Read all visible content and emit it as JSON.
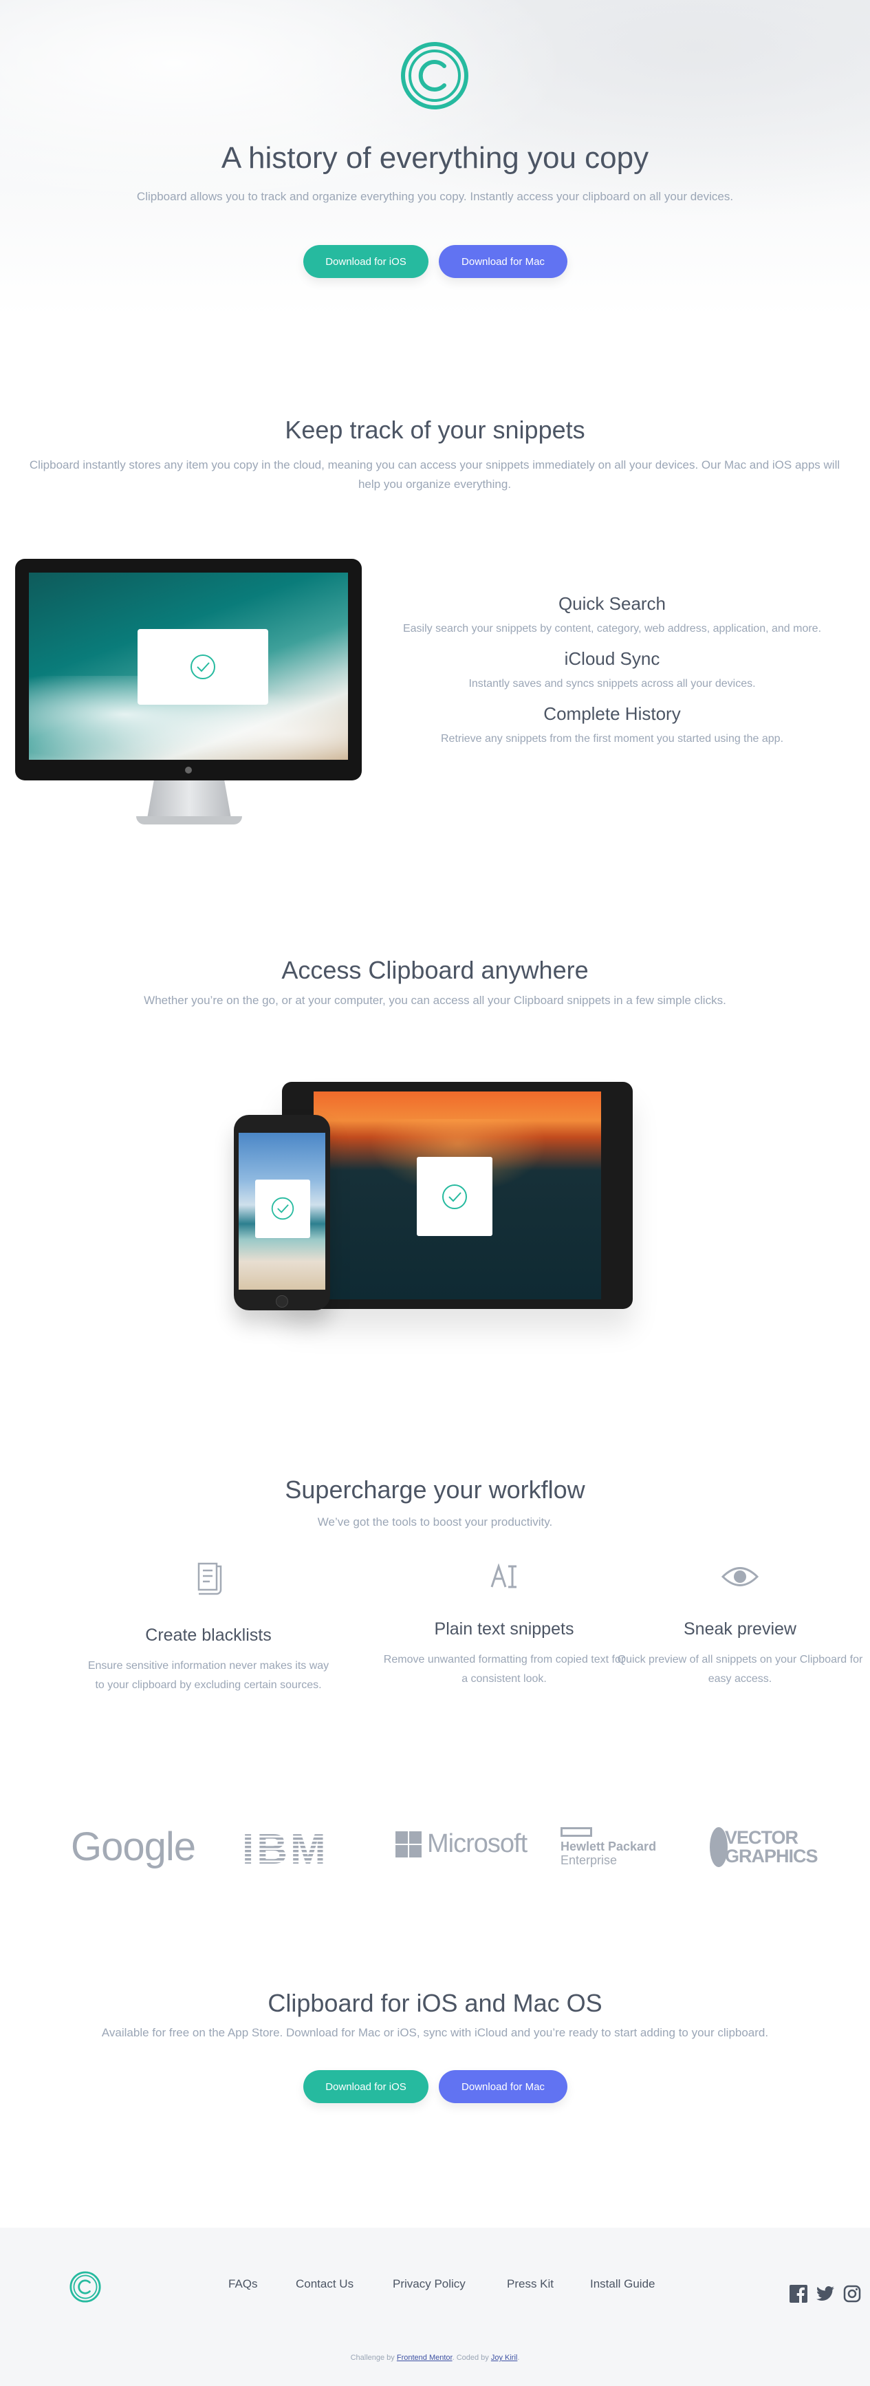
{
  "hero": {
    "title": "A history of everything you copy",
    "subtitle": "Clipboard allows you to track and organize everything you copy. Instantly access your clipboard on all your devices.",
    "btn_ios": "Download for iOS",
    "btn_mac": "Download for Mac"
  },
  "snippets": {
    "title": "Keep track of your snippets",
    "subtitle": "Clipboard instantly stores any item you copy in the cloud, meaning you can access your snippets immediately on all your devices. Our Mac and iOS apps will help you organize everything.",
    "features": [
      {
        "title": "Quick Search",
        "desc": "Easily search your snippets by content, category, web address, application, and more."
      },
      {
        "title": "iCloud Sync",
        "desc": "Instantly saves and syncs snippets across all your devices."
      },
      {
        "title": "Complete History",
        "desc": "Retrieve any snippets from the first moment you started using the app."
      }
    ]
  },
  "access": {
    "title": "Access Clipboard anywhere",
    "subtitle": "Whether you’re on the go, or at your computer, you can access all your Clipboard snippets in a few simple clicks."
  },
  "workflow": {
    "title": "Supercharge your workflow",
    "subtitle": "We’ve got the tools to boost your productivity.",
    "items": [
      {
        "title": "Create blacklists",
        "desc": "Ensure sensitive information never makes its way to your clipboard by excluding certain sources.",
        "icon": "blacklist-icon"
      },
      {
        "title": "Plain text snippets",
        "desc": "Remove unwanted formatting from copied text for a consistent look.",
        "icon": "text-icon"
      },
      {
        "title": "Sneak preview",
        "desc": "Quick preview of all snippets on your Clipboard for easy access.",
        "icon": "eye-icon"
      }
    ]
  },
  "logos": {
    "google": "Google",
    "ibm": "IBM",
    "microsoft": "Microsoft",
    "hp_line1": "Hewlett Packard",
    "hp_line2": "Enterprise",
    "vector_line1": "VECTOR",
    "vector_line2": "GRAPHICS"
  },
  "cta": {
    "title": "Clipboard for iOS and Mac OS",
    "subtitle": "Available for free on the App Store. Download for Mac or iOS, sync with iCloud and you’re ready to start adding to your clipboard.",
    "btn_ios": "Download for iOS",
    "btn_mac": "Download for Mac"
  },
  "footer": {
    "links": [
      "FAQs",
      "Contact Us",
      "Privacy Policy",
      "Press Kit",
      "Install Guide"
    ],
    "credit_prefix": "Challenge by ",
    "credit_link1": "Frontend Mentor",
    "credit_mid": ". Coded by ",
    "credit_link2": "Joy Kiril",
    "credit_suffix": "."
  },
  "colors": {
    "accent_teal": "#26ba9f",
    "accent_blue": "#6173f2",
    "heading": "#4c5564",
    "body_text": "#9ba6b6"
  }
}
